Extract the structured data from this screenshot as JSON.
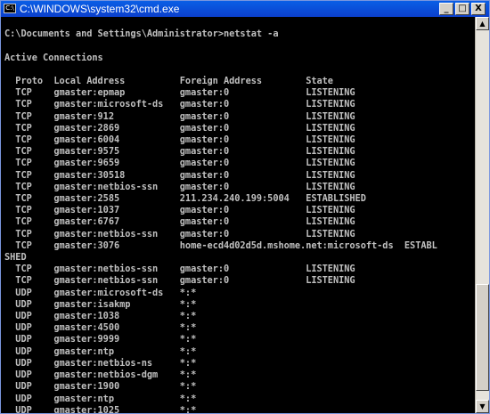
{
  "window": {
    "title": "C:\\WINDOWS\\system32\\cmd.exe",
    "icon_label": "C:\\",
    "buttons": {
      "minimize": "_",
      "maximize": "□",
      "close": "X"
    }
  },
  "console": {
    "lines": [
      "",
      "C:\\Documents and Settings\\Administrator>netstat -a",
      "",
      "Active Connections",
      "",
      "  Proto  Local Address          Foreign Address        State",
      "  TCP    gmaster:epmap          gmaster:0              LISTENING",
      "  TCP    gmaster:microsoft-ds   gmaster:0              LISTENING",
      "  TCP    gmaster:912            gmaster:0              LISTENING",
      "  TCP    gmaster:2869           gmaster:0              LISTENING",
      "  TCP    gmaster:6004           gmaster:0              LISTENING",
      "  TCP    gmaster:9575           gmaster:0              LISTENING",
      "  TCP    gmaster:9659           gmaster:0              LISTENING",
      "  TCP    gmaster:30518          gmaster:0              LISTENING",
      "  TCP    gmaster:netbios-ssn    gmaster:0              LISTENING",
      "  TCP    gmaster:2585           211.234.240.199:5004   ESTABLISHED",
      "  TCP    gmaster:1037           gmaster:0              LISTENING",
      "  TCP    gmaster:6767           gmaster:0              LISTENING",
      "  TCP    gmaster:netbios-ssn    gmaster:0              LISTENING",
      "  TCP    gmaster:3076           home-ecd4d02d5d.mshome.net:microsoft-ds  ESTABL",
      "SHED",
      "  TCP    gmaster:netbios-ssn    gmaster:0              LISTENING",
      "  TCP    gmaster:netbios-ssn    gmaster:0              LISTENING",
      "  UDP    gmaster:microsoft-ds   *:*",
      "  UDP    gmaster:isakmp         *:*",
      "  UDP    gmaster:1038           *:*",
      "  UDP    gmaster:4500           *:*",
      "  UDP    gmaster:9999           *:*",
      "  UDP    gmaster:ntp            *:*",
      "  UDP    gmaster:netbios-ns     *:*",
      "  UDP    gmaster:netbios-dgm    *:*",
      "  UDP    gmaster:1900           *:*",
      "  UDP    gmaster:ntp            *:*",
      "  UDP    gmaster:1025           *:*"
    ]
  },
  "scrollbar": {
    "up_arrow": "▲",
    "down_arrow": "▼"
  }
}
